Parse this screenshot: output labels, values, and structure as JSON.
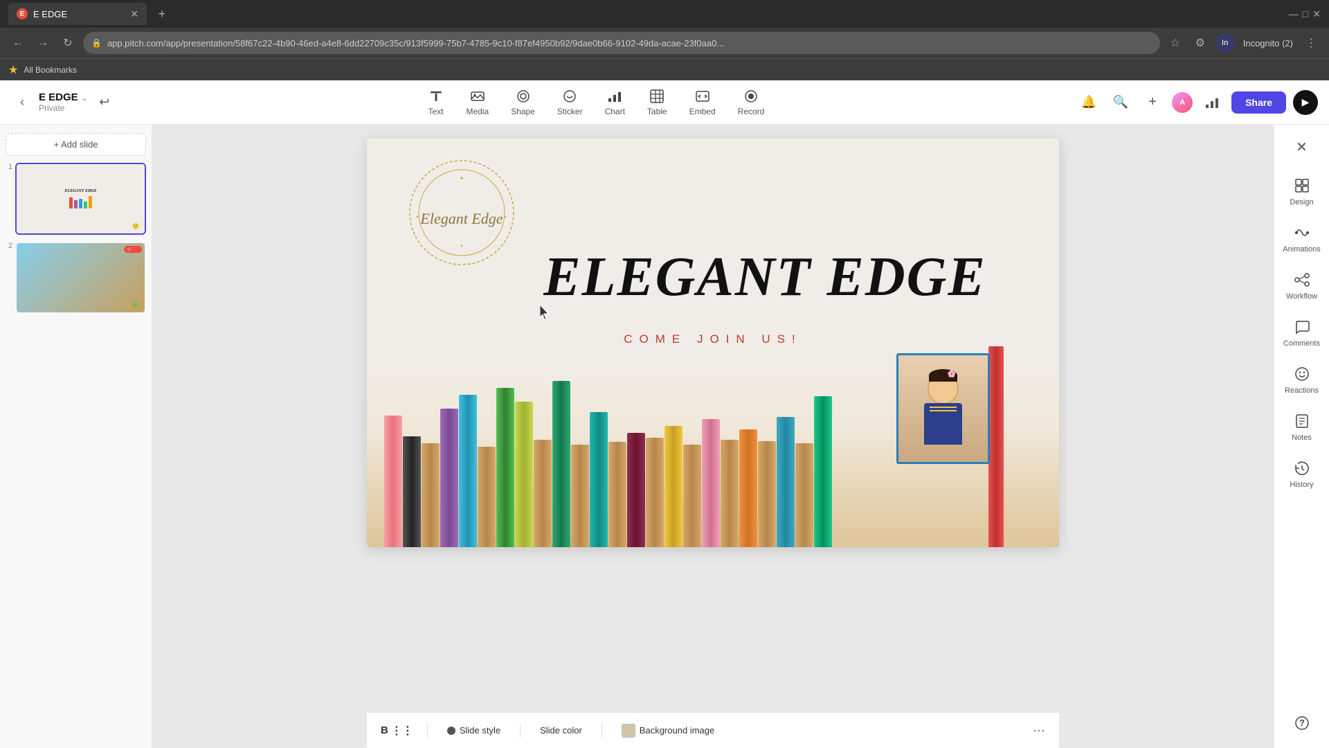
{
  "browser": {
    "tab_title": "E EDGE",
    "url": "app.pitch.com/app/presentation/58f67c22-4b90-46ed-a4e8-6dd22709c35c/913f5999-75b7-4785-9c10-f87ef4950b92/9dae0b66-9102-49da-acae-23f0aa0...",
    "bookmarks_label": "All Bookmarks"
  },
  "app": {
    "project_name": "E EDGE",
    "project_visibility": "Private",
    "share_btn": "Share"
  },
  "toolbar": {
    "tools": [
      {
        "id": "text",
        "label": "Text",
        "icon": "T"
      },
      {
        "id": "media",
        "label": "Media",
        "icon": "▣"
      },
      {
        "id": "shape",
        "label": "Shape",
        "icon": "◎"
      },
      {
        "id": "sticker",
        "label": "Sticker",
        "icon": "✦"
      },
      {
        "id": "chart",
        "label": "Chart",
        "icon": "▦"
      },
      {
        "id": "table",
        "label": "Table",
        "icon": "⊞"
      },
      {
        "id": "embed",
        "label": "Embed",
        "icon": "⊏"
      },
      {
        "id": "record",
        "label": "Record",
        "icon": "⊙"
      }
    ]
  },
  "slide": {
    "main_title": "ELEGANT EDGE",
    "subtitle": "COME JOIN US!",
    "logo_text": "Elegant Edge"
  },
  "bottom_bar": {
    "slide_style": "Slide style",
    "slide_color": "Slide color",
    "background_image": "Background image"
  },
  "right_sidebar": {
    "items": [
      {
        "id": "design",
        "label": "Design"
      },
      {
        "id": "animations",
        "label": "Animations"
      },
      {
        "id": "workflow",
        "label": "Workflow"
      },
      {
        "id": "comments",
        "label": "Comments"
      },
      {
        "id": "reactions",
        "label": "Reactions"
      },
      {
        "id": "notes",
        "label": "Notes"
      },
      {
        "id": "history",
        "label": "History"
      }
    ]
  },
  "add_slide_label": "+ Add slide",
  "slide_numbers": [
    "1",
    "2"
  ]
}
